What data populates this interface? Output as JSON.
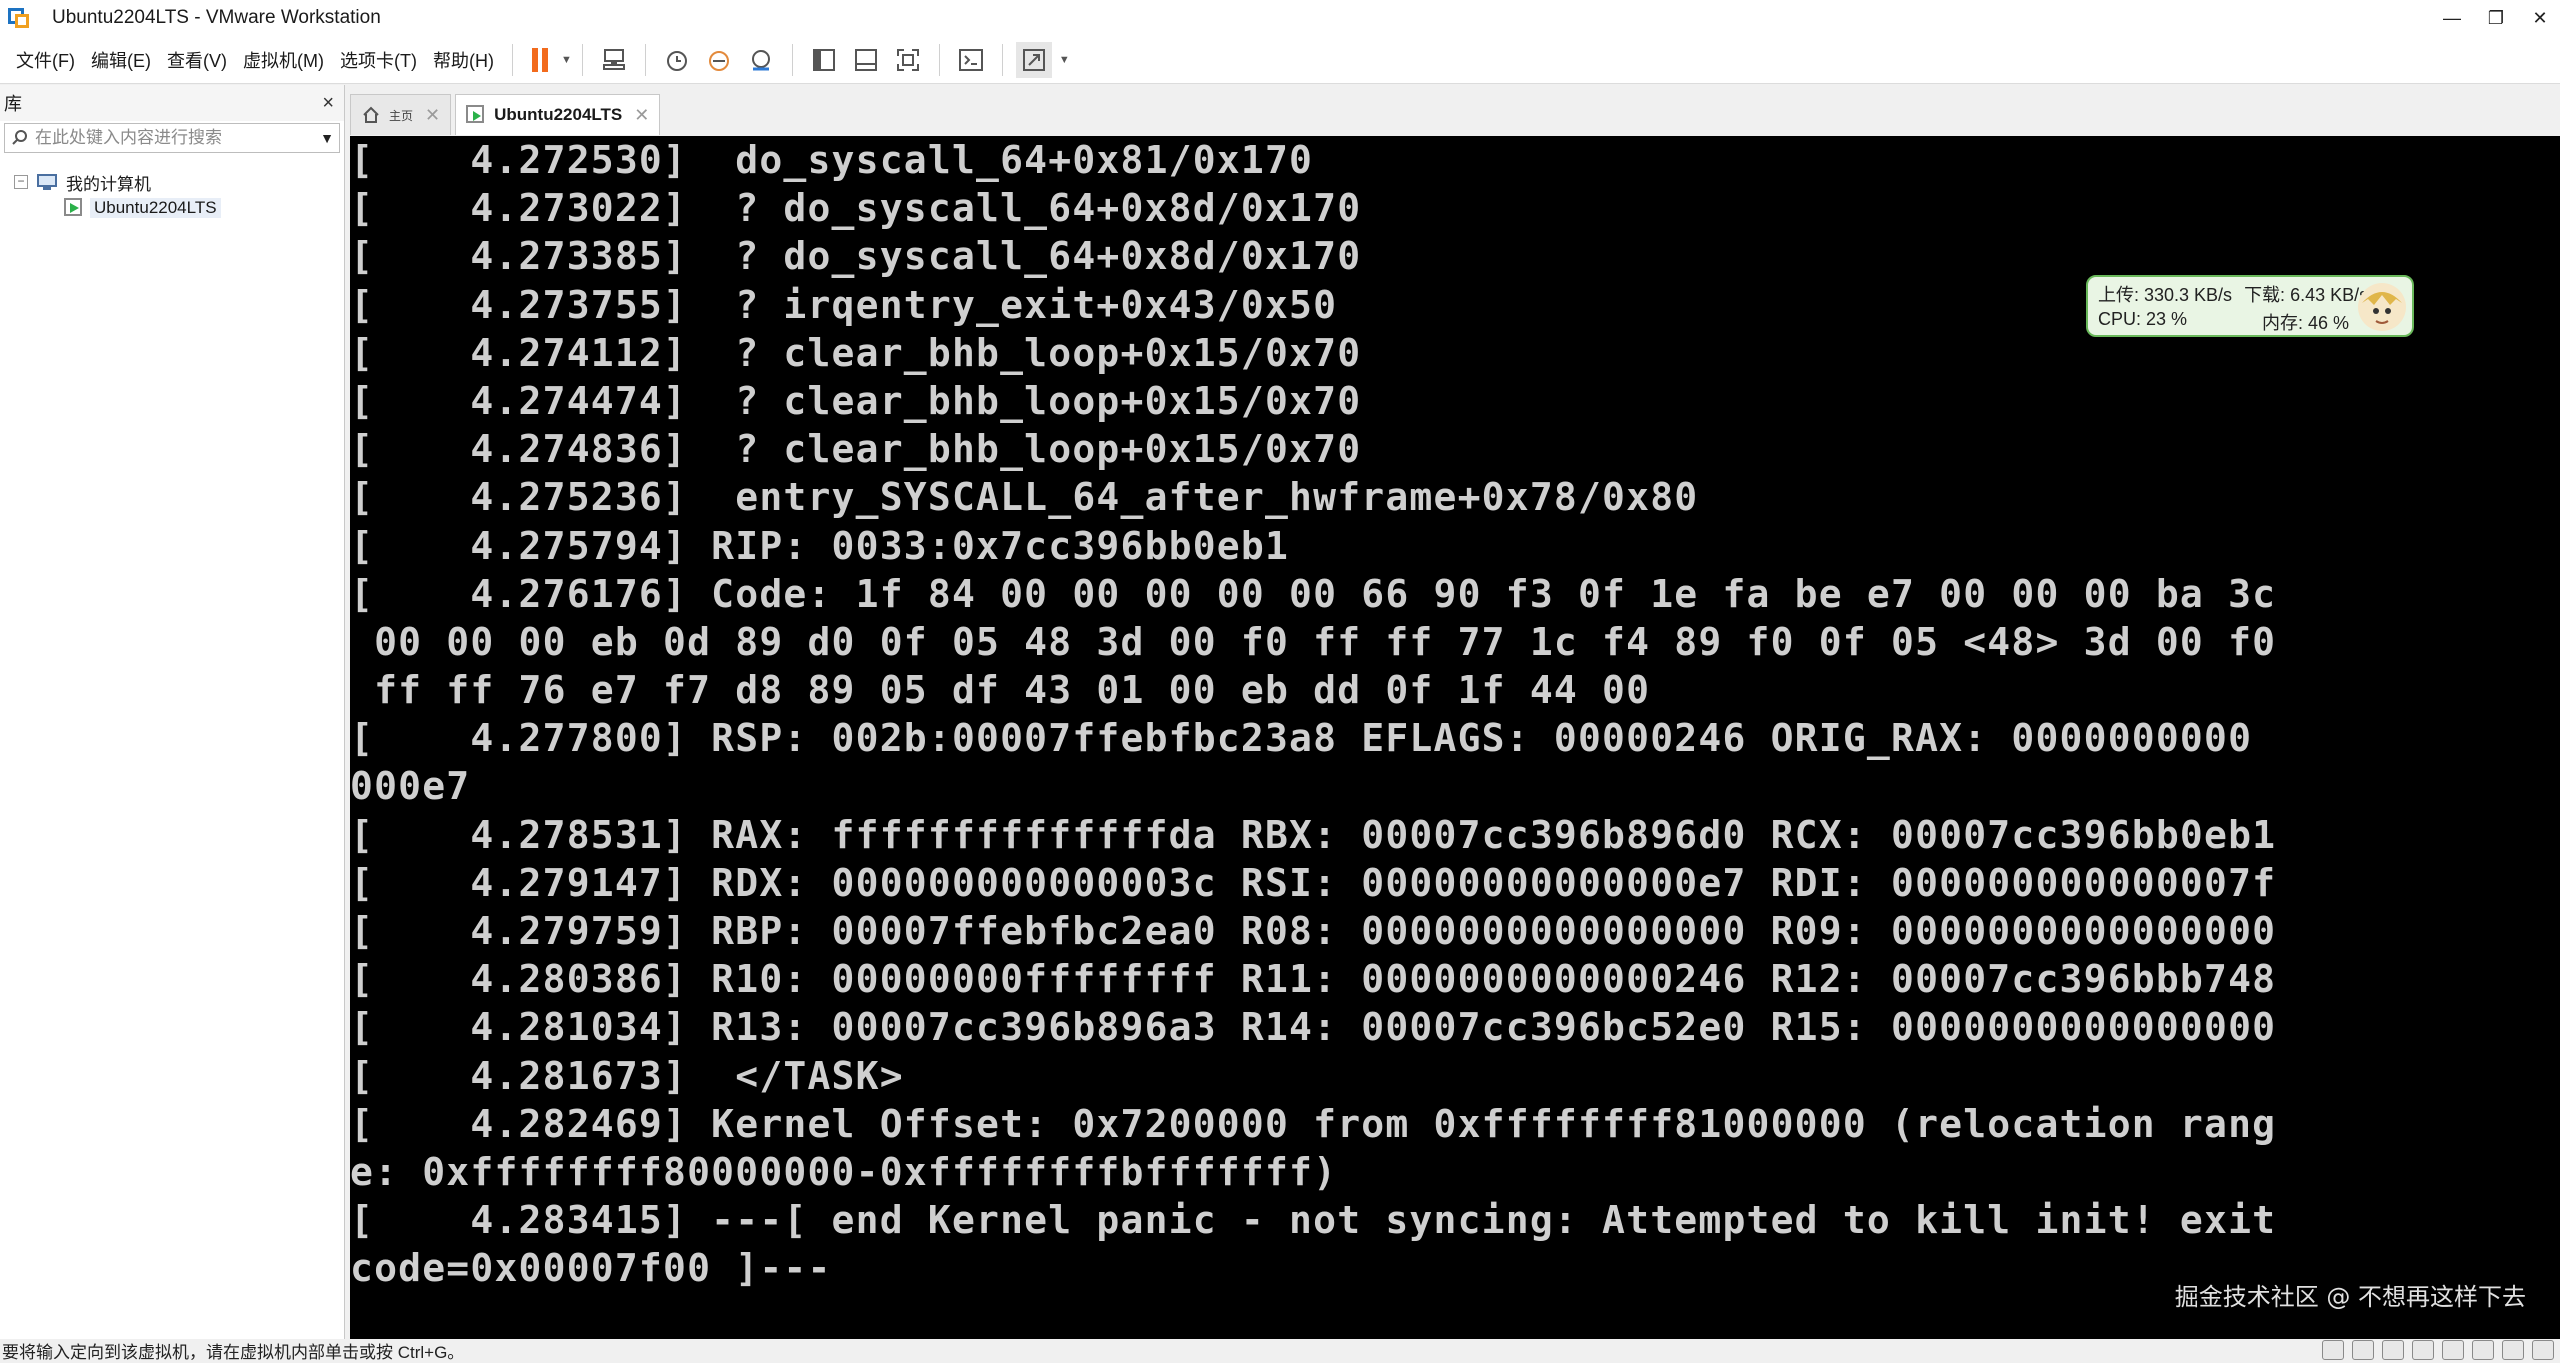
{
  "window": {
    "title": "Ubuntu2204LTS - VMware Workstation",
    "minimize": "—",
    "restore": "❐",
    "close": "✕"
  },
  "menu": [
    "文件(F)",
    "编辑(E)",
    "查看(V)",
    "虚拟机(M)",
    "选项卡(T)",
    "帮助(H)"
  ],
  "library": {
    "title": "库",
    "close": "×",
    "search_placeholder": "在此处键入内容进行搜索",
    "tree_root": "我的计算机",
    "tree_vm": "Ubuntu2204LTS"
  },
  "tabs": {
    "home_label": "主页",
    "active_label": "Ubuntu2204LTS",
    "close": "✕"
  },
  "console_lines": [
    "[    4.272530]  do_syscall_64+0x81/0x170",
    "[    4.273022]  ? do_syscall_64+0x8d/0x170",
    "[    4.273385]  ? do_syscall_64+0x8d/0x170",
    "[    4.273755]  ? irqentry_exit+0x43/0x50",
    "[    4.274112]  ? clear_bhb_loop+0x15/0x70",
    "[    4.274474]  ? clear_bhb_loop+0x15/0x70",
    "[    4.274836]  ? clear_bhb_loop+0x15/0x70",
    "[    4.275236]  entry_SYSCALL_64_after_hwframe+0x78/0x80",
    "[    4.275794] RIP: 0033:0x7cc396bb0eb1",
    "[    4.276176] Code: 1f 84 00 00 00 00 00 66 90 f3 0f 1e fa be e7 00 00 00 ba 3c",
    " 00 00 00 eb 0d 89 d0 0f 05 48 3d 00 f0 ff ff 77 1c f4 89 f0 0f 05 <48> 3d 00 f0",
    " ff ff 76 e7 f7 d8 89 05 df 43 01 00 eb dd 0f 1f 44 00",
    "[    4.277800] RSP: 002b:00007ffebfbc23a8 EFLAGS: 00000246 ORIG_RAX: 0000000000",
    "000e7",
    "[    4.278531] RAX: ffffffffffffffda RBX: 00007cc396b896d0 RCX: 00007cc396bb0eb1",
    "[    4.279147] RDX: 000000000000003c RSI: 00000000000000e7 RDI: 000000000000007f",
    "[    4.279759] RBP: 00007ffebfbc2ea0 R08: 0000000000000000 R09: 0000000000000000",
    "[    4.280386] R10: 00000000ffffffff R11: 0000000000000246 R12: 00007cc396bbb748",
    "[    4.281034] R13: 00007cc396b896a3 R14: 00007cc396bc52e0 R15: 0000000000000000",
    "[    4.281673]  </TASK>",
    "[    4.282469] Kernel Offset: 0x7200000 from 0xffffffff81000000 (relocation rang",
    "e: 0xffffffff80000000-0xffffffffbfffffff)",
    "[    4.283415] ---[ end Kernel panic - not syncing: Attempted to kill init! exit",
    "code=0x00007f00 ]---"
  ],
  "watermark": "掘金技术社区 @ 不想再这样下去",
  "netmon": {
    "upload": "上传: 330.3 KB/s",
    "download": "下载: 6.43 KB/s",
    "cpu": "CPU: 23 %",
    "memory": "内存: 46 %"
  },
  "status": {
    "text": "要将输入定向到该虚拟机，请在虚拟机内部单击或按 Ctrl+G。"
  },
  "colors": {
    "pause": "#f26b1d",
    "console_bg": "#000000",
    "console_fg": "#cfcfcf",
    "netmon_border": "#69b85a"
  }
}
